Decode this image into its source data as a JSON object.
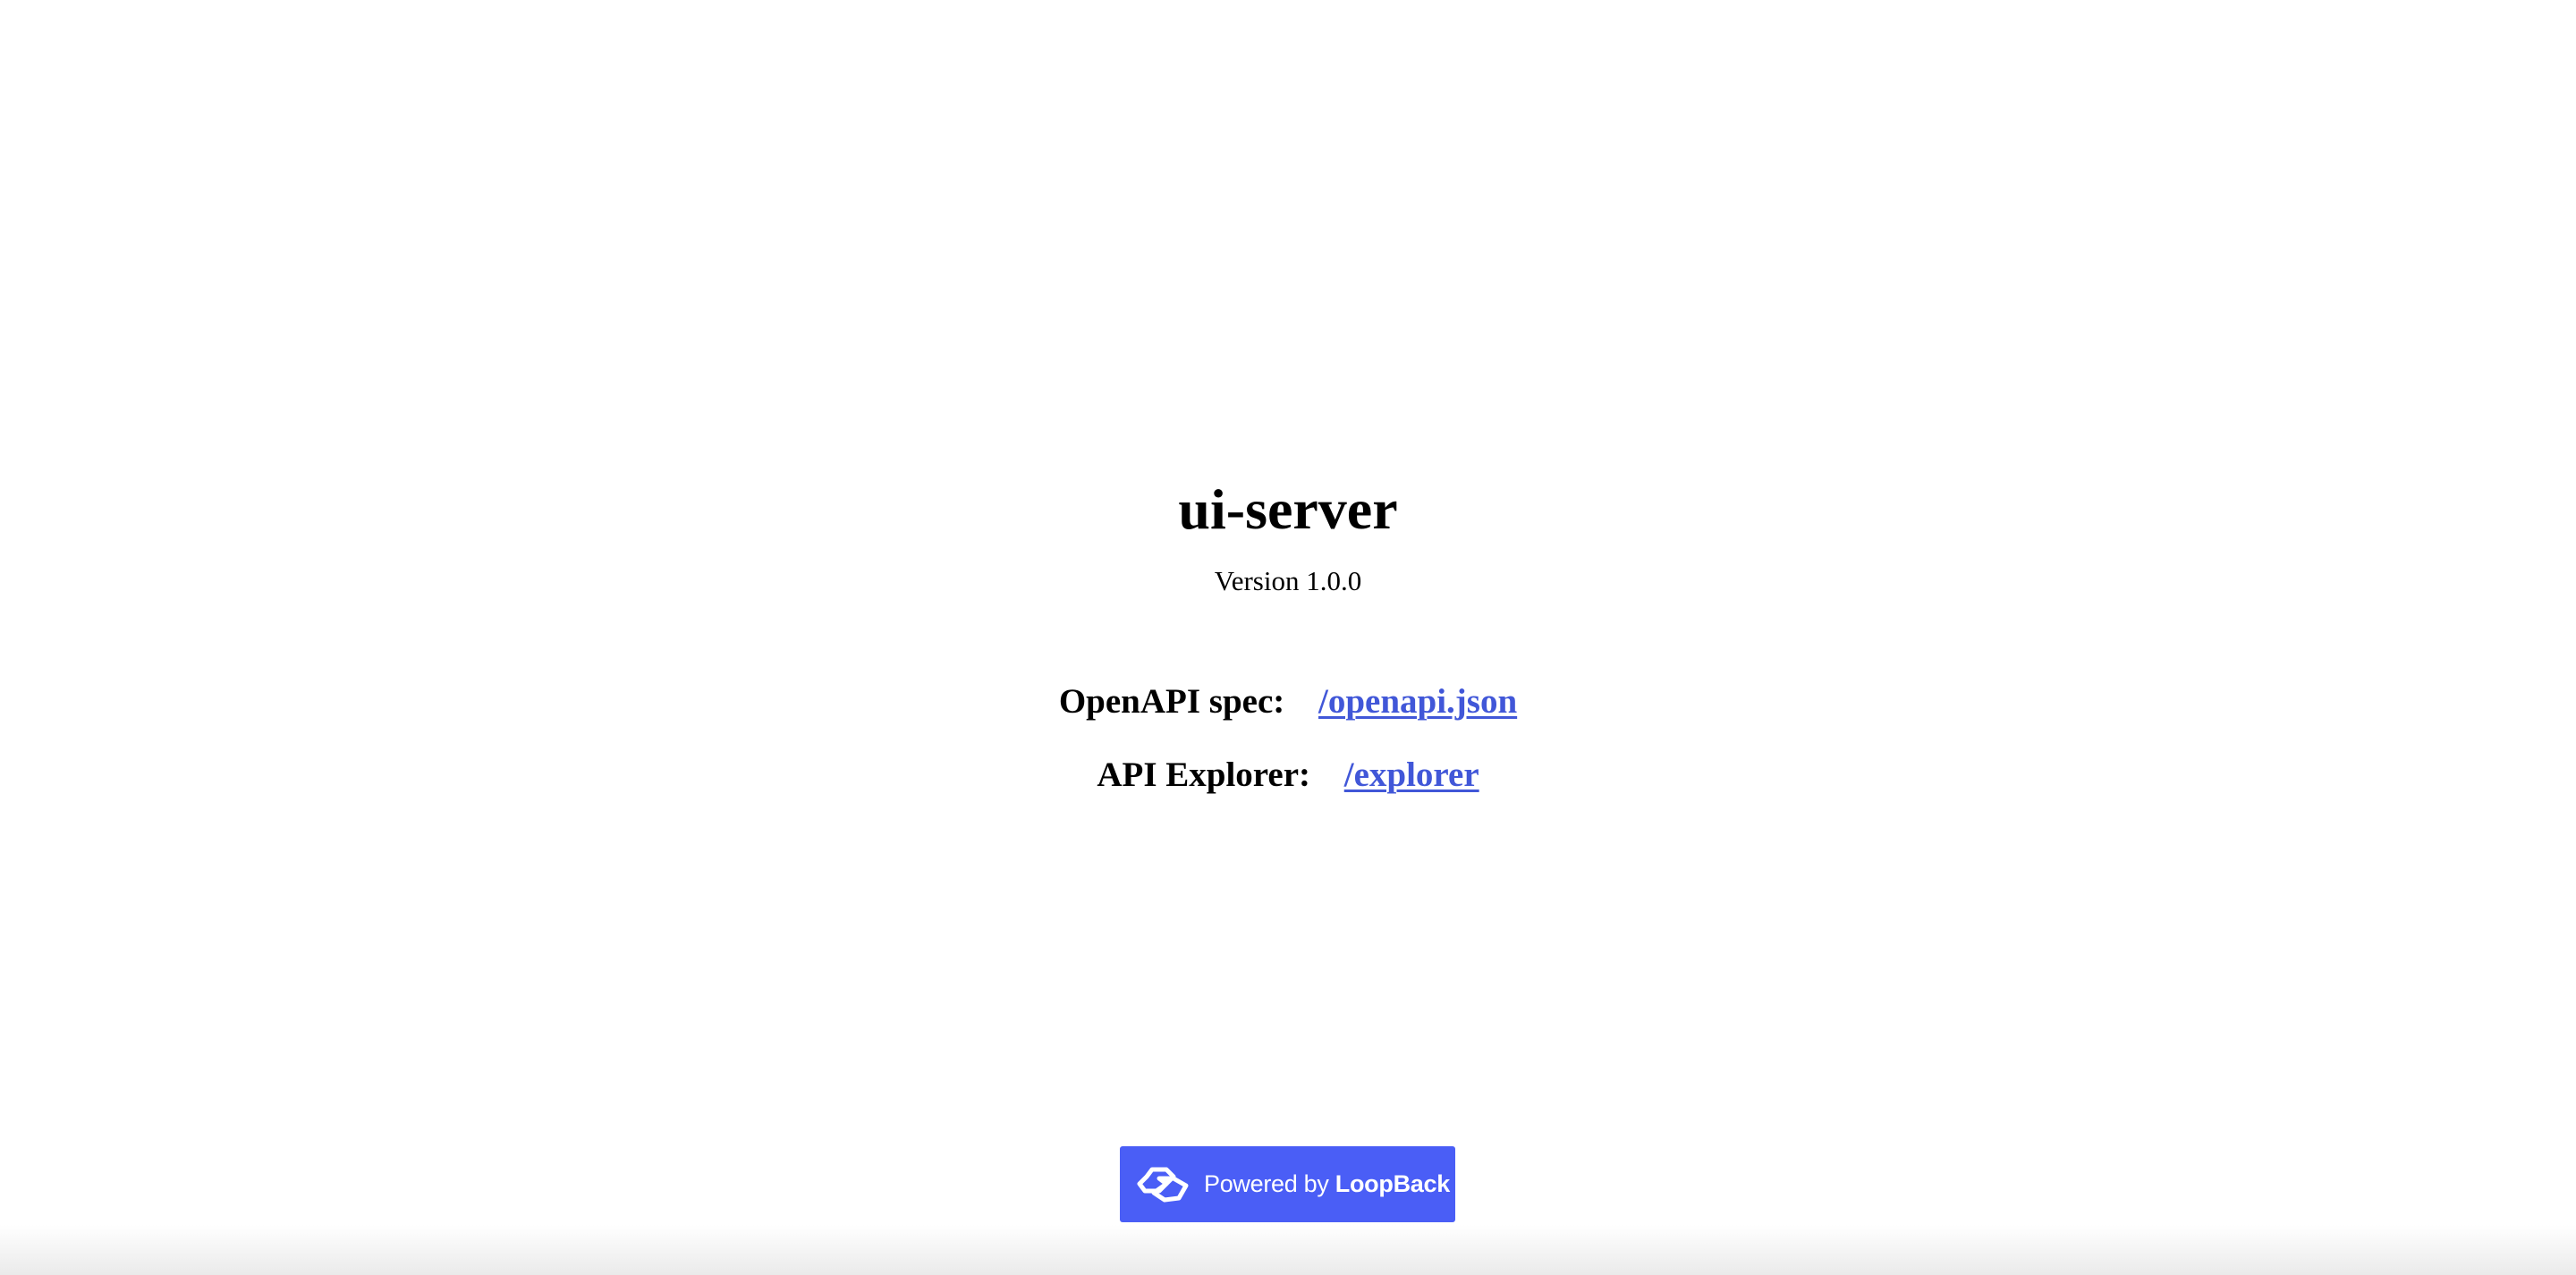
{
  "app": {
    "title": "ui-server",
    "version": "Version 1.0.0"
  },
  "links": [
    {
      "label": "OpenAPI spec:",
      "text": "/openapi.json",
      "href": "/openapi.json"
    },
    {
      "label": "API Explorer:",
      "text": "/explorer",
      "href": "/explorer"
    }
  ],
  "footer": {
    "powered_by": "Powered by",
    "brand": "LoopBack",
    "logo_icon": "loopback-logo-icon",
    "badge_color": "#4a5ef6"
  },
  "colors": {
    "link": "#4157d8",
    "text": "#000000",
    "background": "#ffffff"
  }
}
